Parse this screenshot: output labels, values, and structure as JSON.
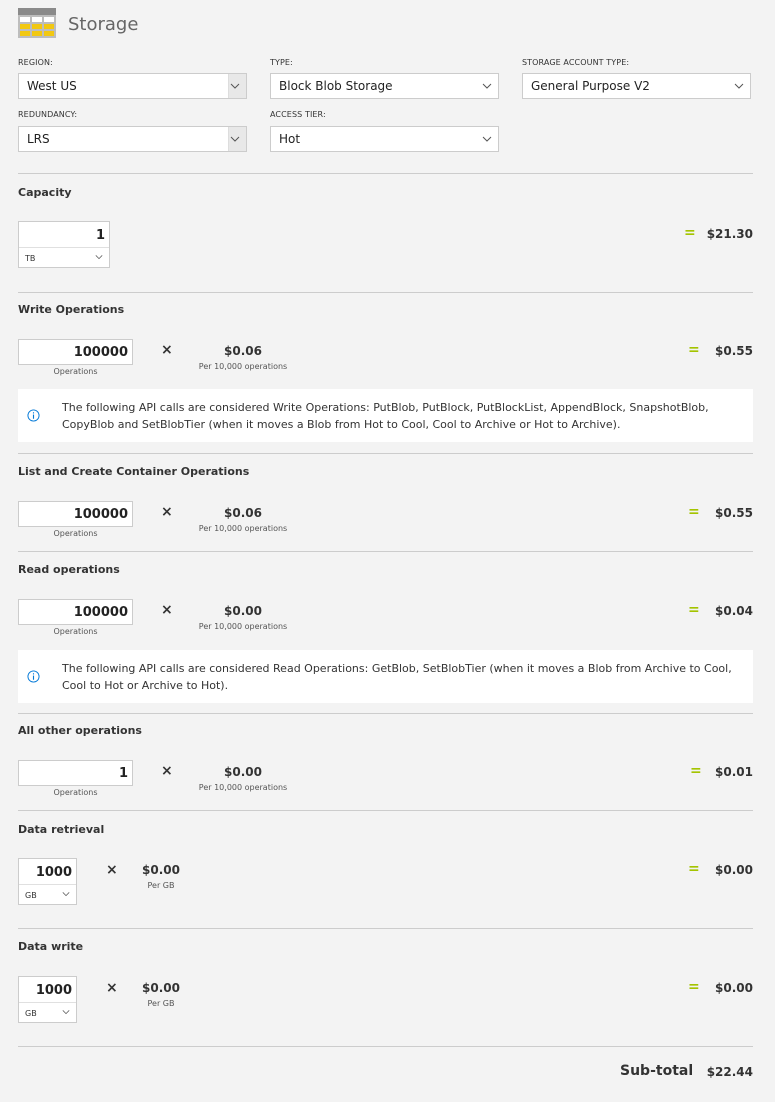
{
  "header": {
    "title": "Storage",
    "icon": "storage-table-icon"
  },
  "config": {
    "region": {
      "label": "REGION:",
      "value": "West US"
    },
    "type": {
      "label": "TYPE:",
      "value": "Block Blob Storage"
    },
    "account_type": {
      "label": "STORAGE ACCOUNT TYPE:",
      "value": "General Purpose V2"
    },
    "redundancy": {
      "label": "REDUNDANCY:",
      "value": "LRS"
    },
    "access_tier": {
      "label": "ACCESS TIER:",
      "value": "Hot"
    }
  },
  "capacity": {
    "title": "Capacity",
    "qty": "1",
    "unit": "TB",
    "total": "$21.30"
  },
  "write_ops": {
    "title": "Write Operations",
    "qty": "100000",
    "qty_label": "Operations",
    "price": "$0.06",
    "price_label": "Per 10,000 operations",
    "total": "$0.55",
    "info": "The following API calls are considered Write Operations: PutBlob, PutBlock, PutBlockList, AppendBlock, SnapshotBlob, CopyBlob and SetBlobTier (when it moves a Blob from Hot to Cool, Cool to Archive or Hot to Archive)."
  },
  "list_ops": {
    "title": "List and Create Container Operations",
    "qty": "100000",
    "qty_label": "Operations",
    "price": "$0.06",
    "price_label": "Per 10,000 operations",
    "total": "$0.55"
  },
  "read_ops": {
    "title": "Read operations",
    "qty": "100000",
    "qty_label": "Operations",
    "price": "$0.00",
    "price_label": "Per 10,000 operations",
    "total": "$0.04",
    "info": "The following API calls are considered Read Operations: GetBlob, SetBlobTier (when it moves a Blob from Archive to Cool, Cool to Hot or Archive to Hot)."
  },
  "other_ops": {
    "title": "All other operations",
    "qty": "1",
    "qty_label": "Operations",
    "price": "$0.00",
    "price_label": "Per 10,000 operations",
    "total": "$0.01"
  },
  "data_retrieval": {
    "title": "Data retrieval",
    "qty": "1000",
    "unit": "GB",
    "price": "$0.00",
    "price_label": "Per GB",
    "total": "$0.00"
  },
  "data_write": {
    "title": "Data write",
    "qty": "1000",
    "unit": "GB",
    "price": "$0.00",
    "price_label": "Per GB",
    "total": "$0.00"
  },
  "symbols": {
    "times": "×",
    "equals": "="
  },
  "subtotal": {
    "label": "Sub-total",
    "value": "$22.44"
  },
  "colors": {
    "accent": "#a4c400",
    "info_icon": "#0078d7",
    "icon_yellow": "#f2c811"
  }
}
